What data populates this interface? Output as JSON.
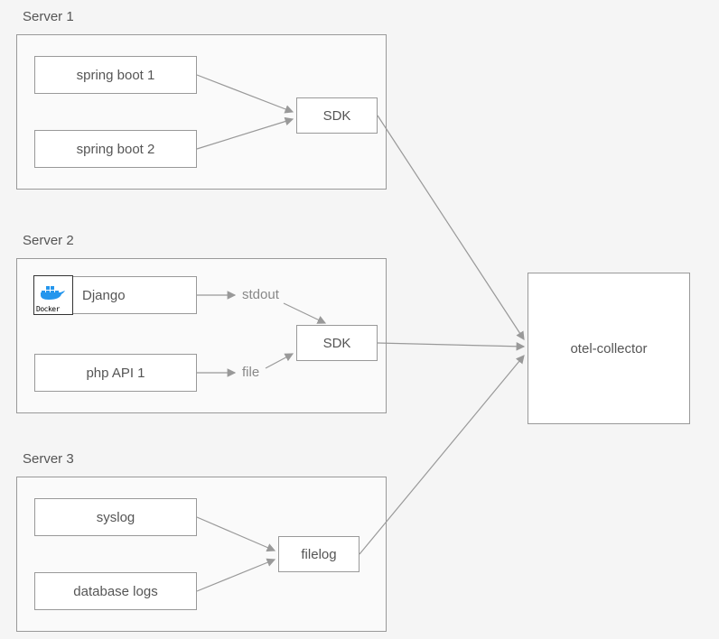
{
  "server1": {
    "label": "Server 1",
    "spring_boot_1": "spring boot 1",
    "spring_boot_2": "spring boot 2",
    "sdk": "SDK"
  },
  "server2": {
    "label": "Server 2",
    "django": "Django",
    "php_api_1": "php API 1",
    "sdk": "SDK",
    "stdout": "stdout",
    "file": "file"
  },
  "server3": {
    "label": "Server 3",
    "syslog": "syslog",
    "database_logs": "database logs",
    "filelog": "filelog"
  },
  "collector": "otel-collector",
  "docker_label": "Docker"
}
